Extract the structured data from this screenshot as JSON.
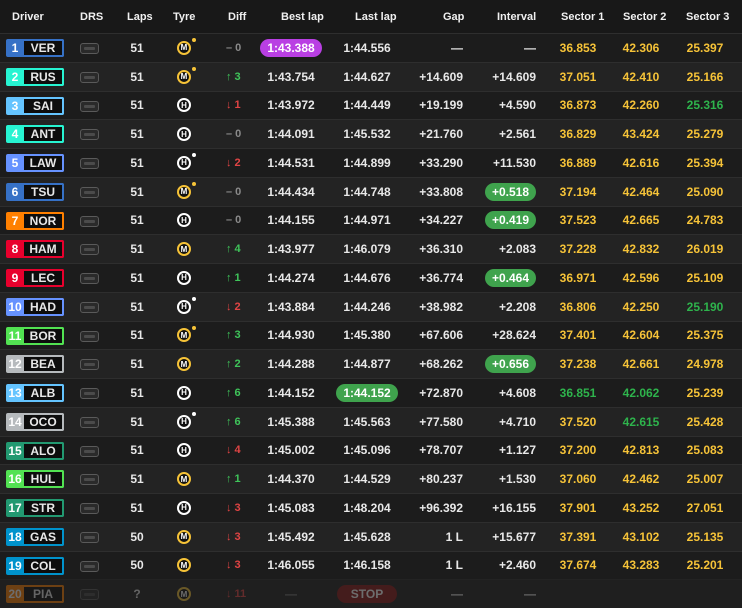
{
  "headers": {
    "driver": "Driver",
    "drs": "DRS",
    "laps": "Laps",
    "tyre": "Tyre",
    "diff": "Diff",
    "best_lap": "Best lap",
    "last_lap": "Last lap",
    "gap": "Gap",
    "interval": "Interval",
    "sector1": "Sector 1",
    "sector2": "Sector 2",
    "sector3": "Sector 3"
  },
  "colors": {
    "sector_yellow": "#f6c338",
    "sector_green": "#2eb34c",
    "purple": "#b93fe3",
    "pill_green": "#3fa34d",
    "stop": "#8b1a1a",
    "up": "#3fc45a",
    "down": "#e04444"
  },
  "rows": [
    {
      "pos": "1",
      "code": "VER",
      "team": "#3671c6",
      "laps": "51",
      "tyre": "M",
      "tyre_color": "#f6c338",
      "tyre_new": true,
      "diff_dir": "eq",
      "diff": "0",
      "best": "1:43.388",
      "best_hl": "purple",
      "last": "1:44.556",
      "last_hl": "",
      "gap": "—",
      "interval": "—",
      "int_hl": "",
      "s1": "36.853",
      "s1c": "yellow",
      "s2": "42.306",
      "s2c": "yellow",
      "s3": "25.397",
      "s3c": "yellow"
    },
    {
      "pos": "2",
      "code": "RUS",
      "team": "#27f4d2",
      "laps": "51",
      "tyre": "M",
      "tyre_color": "#f6c338",
      "tyre_new": true,
      "diff_dir": "up",
      "diff": "3",
      "best": "1:43.754",
      "best_hl": "",
      "last": "1:44.627",
      "last_hl": "",
      "gap": "+14.609",
      "interval": "+14.609",
      "int_hl": "",
      "s1": "37.051",
      "s1c": "yellow",
      "s2": "42.410",
      "s2c": "yellow",
      "s3": "25.166",
      "s3c": "yellow"
    },
    {
      "pos": "3",
      "code": "SAI",
      "team": "#64c4ff",
      "laps": "51",
      "tyre": "H",
      "tyre_color": "#ffffff",
      "tyre_new": false,
      "diff_dir": "down",
      "diff": "1",
      "best": "1:43.972",
      "best_hl": "",
      "last": "1:44.449",
      "last_hl": "",
      "gap": "+19.199",
      "interval": "+4.590",
      "int_hl": "",
      "s1": "36.873",
      "s1c": "yellow",
      "s2": "42.260",
      "s2c": "yellow",
      "s3": "25.316",
      "s3c": "green"
    },
    {
      "pos": "4",
      "code": "ANT",
      "team": "#27f4d2",
      "laps": "51",
      "tyre": "H",
      "tyre_color": "#ffffff",
      "tyre_new": false,
      "diff_dir": "eq",
      "diff": "0",
      "best": "1:44.091",
      "best_hl": "",
      "last": "1:45.532",
      "last_hl": "",
      "gap": "+21.760",
      "interval": "+2.561",
      "int_hl": "",
      "s1": "36.829",
      "s1c": "yellow",
      "s2": "43.424",
      "s2c": "yellow",
      "s3": "25.279",
      "s3c": "yellow"
    },
    {
      "pos": "5",
      "code": "LAW",
      "team": "#6692ff",
      "laps": "51",
      "tyre": "H",
      "tyre_color": "#ffffff",
      "tyre_new": true,
      "diff_dir": "down",
      "diff": "2",
      "best": "1:44.531",
      "best_hl": "",
      "last": "1:44.899",
      "last_hl": "",
      "gap": "+33.290",
      "interval": "+11.530",
      "int_hl": "",
      "s1": "36.889",
      "s1c": "yellow",
      "s2": "42.616",
      "s2c": "yellow",
      "s3": "25.394",
      "s3c": "yellow"
    },
    {
      "pos": "6",
      "code": "TSU",
      "team": "#3671c6",
      "laps": "51",
      "tyre": "M",
      "tyre_color": "#f6c338",
      "tyre_new": true,
      "diff_dir": "eq",
      "diff": "0",
      "best": "1:44.434",
      "best_hl": "",
      "last": "1:44.748",
      "last_hl": "",
      "gap": "+33.808",
      "interval": "+0.518",
      "int_hl": "green",
      "s1": "37.194",
      "s1c": "yellow",
      "s2": "42.464",
      "s2c": "yellow",
      "s3": "25.090",
      "s3c": "yellow"
    },
    {
      "pos": "7",
      "code": "NOR",
      "team": "#ff8000",
      "laps": "51",
      "tyre": "H",
      "tyre_color": "#ffffff",
      "tyre_new": false,
      "diff_dir": "eq",
      "diff": "0",
      "best": "1:44.155",
      "best_hl": "",
      "last": "1:44.971",
      "last_hl": "",
      "gap": "+34.227",
      "interval": "+0.419",
      "int_hl": "green",
      "s1": "37.523",
      "s1c": "yellow",
      "s2": "42.665",
      "s2c": "yellow",
      "s3": "24.783",
      "s3c": "yellow"
    },
    {
      "pos": "8",
      "code": "HAM",
      "team": "#e8002d",
      "laps": "51",
      "tyre": "M",
      "tyre_color": "#f6c338",
      "tyre_new": false,
      "diff_dir": "up",
      "diff": "4",
      "best": "1:43.977",
      "best_hl": "",
      "last": "1:46.079",
      "last_hl": "",
      "gap": "+36.310",
      "interval": "+2.083",
      "int_hl": "",
      "s1": "37.228",
      "s1c": "yellow",
      "s2": "42.832",
      "s2c": "yellow",
      "s3": "26.019",
      "s3c": "yellow"
    },
    {
      "pos": "9",
      "code": "LEC",
      "team": "#e8002d",
      "laps": "51",
      "tyre": "H",
      "tyre_color": "#ffffff",
      "tyre_new": false,
      "diff_dir": "up",
      "diff": "1",
      "best": "1:44.274",
      "best_hl": "",
      "last": "1:44.676",
      "last_hl": "",
      "gap": "+36.774",
      "interval": "+0.464",
      "int_hl": "green",
      "s1": "36.971",
      "s1c": "yellow",
      "s2": "42.596",
      "s2c": "yellow",
      "s3": "25.109",
      "s3c": "yellow"
    },
    {
      "pos": "10",
      "code": "HAD",
      "team": "#6692ff",
      "laps": "51",
      "tyre": "H",
      "tyre_color": "#ffffff",
      "tyre_new": true,
      "diff_dir": "down",
      "diff": "2",
      "best": "1:43.884",
      "best_hl": "",
      "last": "1:44.246",
      "last_hl": "",
      "gap": "+38.982",
      "interval": "+2.208",
      "int_hl": "",
      "s1": "36.806",
      "s1c": "yellow",
      "s2": "42.250",
      "s2c": "yellow",
      "s3": "25.190",
      "s3c": "green"
    },
    {
      "pos": "11",
      "code": "BOR",
      "team": "#52e252",
      "laps": "51",
      "tyre": "M",
      "tyre_color": "#f6c338",
      "tyre_new": true,
      "diff_dir": "up",
      "diff": "3",
      "best": "1:44.930",
      "best_hl": "",
      "last": "1:45.380",
      "last_hl": "",
      "gap": "+67.606",
      "interval": "+28.624",
      "int_hl": "",
      "s1": "37.401",
      "s1c": "yellow",
      "s2": "42.604",
      "s2c": "yellow",
      "s3": "25.375",
      "s3c": "yellow"
    },
    {
      "pos": "12",
      "code": "BEA",
      "team": "#b6babd",
      "laps": "51",
      "tyre": "M",
      "tyre_color": "#f6c338",
      "tyre_new": false,
      "diff_dir": "up",
      "diff": "2",
      "best": "1:44.288",
      "best_hl": "",
      "last": "1:44.877",
      "last_hl": "",
      "gap": "+68.262",
      "interval": "+0.656",
      "int_hl": "green",
      "s1": "37.238",
      "s1c": "yellow",
      "s2": "42.661",
      "s2c": "yellow",
      "s3": "24.978",
      "s3c": "yellow"
    },
    {
      "pos": "13",
      "code": "ALB",
      "team": "#64c4ff",
      "laps": "51",
      "tyre": "H",
      "tyre_color": "#ffffff",
      "tyre_new": false,
      "diff_dir": "up",
      "diff": "6",
      "best": "1:44.152",
      "best_hl": "",
      "last": "1:44.152",
      "last_hl": "green",
      "gap": "+72.870",
      "interval": "+4.608",
      "int_hl": "",
      "s1": "36.851",
      "s1c": "green",
      "s2": "42.062",
      "s2c": "green",
      "s3": "25.239",
      "s3c": "yellow"
    },
    {
      "pos": "14",
      "code": "OCO",
      "team": "#b6babd",
      "laps": "51",
      "tyre": "H",
      "tyre_color": "#ffffff",
      "tyre_new": true,
      "diff_dir": "up",
      "diff": "6",
      "best": "1:45.388",
      "best_hl": "",
      "last": "1:45.563",
      "last_hl": "",
      "gap": "+77.580",
      "interval": "+4.710",
      "int_hl": "",
      "s1": "37.520",
      "s1c": "yellow",
      "s2": "42.615",
      "s2c": "green",
      "s3": "25.428",
      "s3c": "yellow"
    },
    {
      "pos": "15",
      "code": "ALO",
      "team": "#229971",
      "laps": "51",
      "tyre": "H",
      "tyre_color": "#ffffff",
      "tyre_new": false,
      "diff_dir": "down",
      "diff": "4",
      "best": "1:45.002",
      "best_hl": "",
      "last": "1:45.096",
      "last_hl": "",
      "gap": "+78.707",
      "interval": "+1.127",
      "int_hl": "",
      "s1": "37.200",
      "s1c": "yellow",
      "s2": "42.813",
      "s2c": "yellow",
      "s3": "25.083",
      "s3c": "yellow"
    },
    {
      "pos": "16",
      "code": "HUL",
      "team": "#52e252",
      "laps": "51",
      "tyre": "M",
      "tyre_color": "#f6c338",
      "tyre_new": false,
      "diff_dir": "up",
      "diff": "1",
      "best": "1:44.370",
      "best_hl": "",
      "last": "1:44.529",
      "last_hl": "",
      "gap": "+80.237",
      "interval": "+1.530",
      "int_hl": "",
      "s1": "37.060",
      "s1c": "yellow",
      "s2": "42.462",
      "s2c": "yellow",
      "s3": "25.007",
      "s3c": "yellow"
    },
    {
      "pos": "17",
      "code": "STR",
      "team": "#229971",
      "laps": "51",
      "tyre": "H",
      "tyre_color": "#ffffff",
      "tyre_new": false,
      "diff_dir": "down",
      "diff": "3",
      "best": "1:45.083",
      "best_hl": "",
      "last": "1:48.204",
      "last_hl": "",
      "gap": "+96.392",
      "interval": "+16.155",
      "int_hl": "",
      "s1": "37.901",
      "s1c": "yellow",
      "s2": "43.252",
      "s2c": "yellow",
      "s3": "27.051",
      "s3c": "yellow"
    },
    {
      "pos": "18",
      "code": "GAS",
      "team": "#0093cc",
      "laps": "50",
      "tyre": "M",
      "tyre_color": "#f6c338",
      "tyre_new": false,
      "diff_dir": "down",
      "diff": "3",
      "best": "1:45.492",
      "best_hl": "",
      "last": "1:45.628",
      "last_hl": "",
      "gap": "1 L",
      "interval": "+15.677",
      "int_hl": "",
      "s1": "37.391",
      "s1c": "yellow",
      "s2": "43.102",
      "s2c": "yellow",
      "s3": "25.135",
      "s3c": "yellow"
    },
    {
      "pos": "19",
      "code": "COL",
      "team": "#0093cc",
      "laps": "50",
      "tyre": "M",
      "tyre_color": "#f6c338",
      "tyre_new": false,
      "diff_dir": "down",
      "diff": "3",
      "best": "1:46.055",
      "best_hl": "",
      "last": "1:46.158",
      "last_hl": "",
      "gap": "1 L",
      "interval": "+2.460",
      "int_hl": "",
      "s1": "37.674",
      "s1c": "yellow",
      "s2": "43.283",
      "s2c": "yellow",
      "s3": "25.201",
      "s3c": "yellow"
    },
    {
      "pos": "20",
      "code": "PIA",
      "team": "#ff8000",
      "laps": "?",
      "tyre": "M",
      "tyre_color": "#f6c338",
      "tyre_new": false,
      "diff_dir": "down",
      "diff": "11",
      "best": "—",
      "best_hl": "",
      "last": "STOP",
      "last_hl": "stop",
      "gap": "—",
      "interval": "—",
      "int_hl": "",
      "s1": "",
      "s1c": "yellow",
      "s2": "",
      "s2c": "yellow",
      "s3": "",
      "s3c": "yellow",
      "retired": true
    }
  ]
}
